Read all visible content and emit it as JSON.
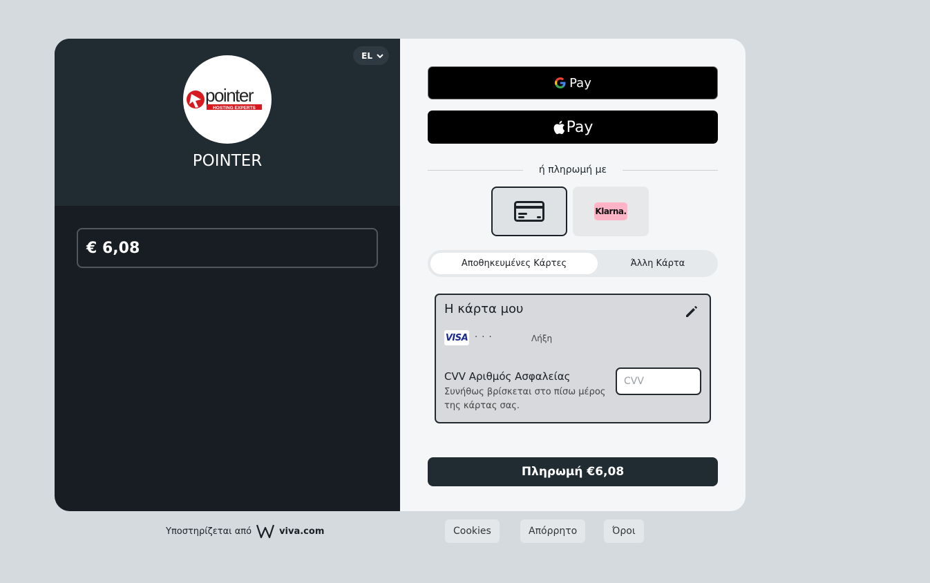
{
  "merchant": {
    "name": "POINTER",
    "logo_text": "pointer",
    "logo_tagline": "HOSTING EXPERTS"
  },
  "language": {
    "selected": "EL"
  },
  "order": {
    "amount": "€ 6,08"
  },
  "wallets": {
    "google_pay": "Pay",
    "apple_pay": "Pay"
  },
  "divider_text": "ή πληρωμή με",
  "methods": {
    "klarna_label": "Klarna."
  },
  "tabs": {
    "saved": "Αποθηκευμένες Κάρτες",
    "other": "Άλλη Κάρτα"
  },
  "saved_card": {
    "title": "Η κάρτα μου",
    "brand": "VISA",
    "masked_number": "· · ·",
    "expiry_label": "Λήξη",
    "cvv_label": "CVV Αριθμός Ασφαλείας",
    "cvv_help": "Συνήθως βρίσκεται στο πίσω μέρος της κάρτας σας.",
    "cvv_placeholder": "CVV"
  },
  "submit_label": "Πληρωμή €6,08",
  "footer": {
    "powered_by": "Υποστηρίζεται από",
    "brand": "viva.com",
    "links": [
      "Cookies",
      "Απόρρητο",
      "Όροι"
    ]
  },
  "colors": {
    "dark": "#171d22",
    "dark_header": "#212b32",
    "klarna_pink": "#ffb3c7",
    "visa_blue": "#1a2b8f"
  }
}
